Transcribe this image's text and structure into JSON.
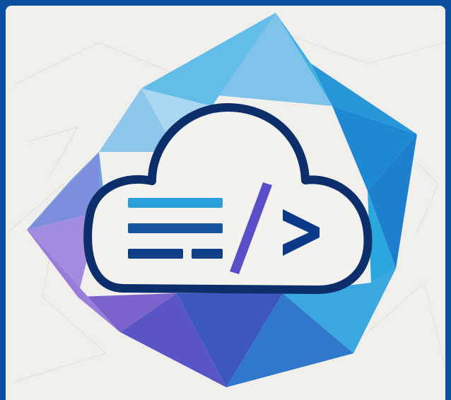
{
  "logo": {
    "name": "cloud-code-logo",
    "icon": "cloud-code-icon",
    "colors": {
      "frame": "#0a4fa0",
      "background": "#f0efeb",
      "cloud_outline": "#0c2f6b",
      "cloud_fill": "#f3f2ee",
      "text_lines": [
        "#2aa0d8",
        "#17569e",
        "#0f3f86"
      ],
      "slash": "#5a4fc8",
      "chevron": "#0c3a8a",
      "facets": [
        "#7fc3ea",
        "#4fb6e2",
        "#2ea4dc",
        "#1f8fd4",
        "#3a76cf",
        "#5b68cc",
        "#7e6ad0",
        "#a58ee0",
        "#9a7fdb",
        "#3c57c0"
      ]
    }
  }
}
